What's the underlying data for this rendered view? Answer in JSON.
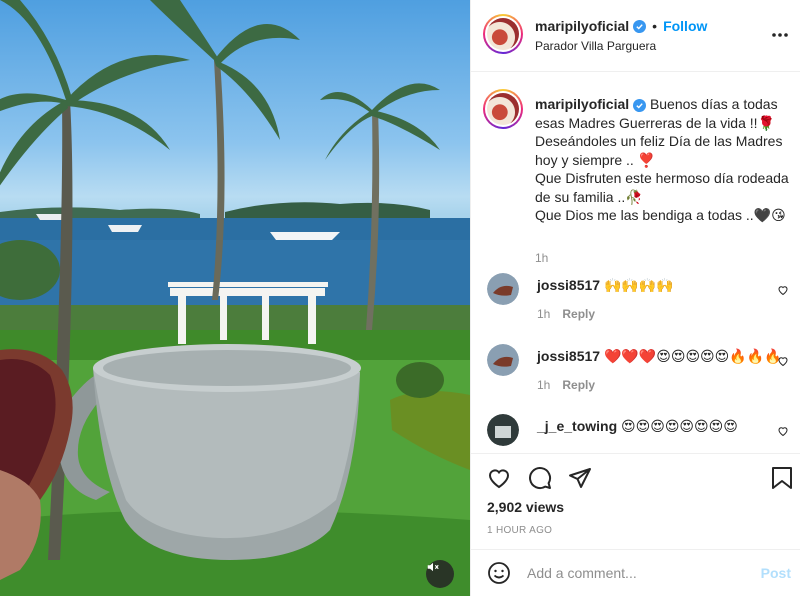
{
  "post": {
    "author": "maripilyoficial",
    "follow_label": "Follow",
    "location": "Parador Villa Parguera",
    "more_icon": "more-horizontal-icon"
  },
  "caption": {
    "username": "maripilyoficial",
    "text": "Buenos días a todas esas Madres Guerreras de la vida !!🌹\nDeseándoles un feliz Día de las Madres hoy y siempre .. ❣️\nQue Disfruten este hermoso día rodeada de su familia ..🥀\nQue Dios me las bendiga a todas ..🖤😘",
    "time": "1h"
  },
  "comments": [
    {
      "username": "jossi8517",
      "text": "🙌🙌🙌🙌",
      "time": "1h",
      "reply_label": "Reply"
    },
    {
      "username": "jossi8517",
      "text": "❤️❤️❤️😍😍😍😍😍🔥🔥🔥",
      "time": "1h",
      "reply_label": "Reply"
    },
    {
      "username": "_j_e_towing",
      "text": "😍😍😍😍😍😍😍😍",
      "time": "",
      "reply_label": ""
    }
  ],
  "stats": {
    "views": "2,902 views",
    "time_ago": "1 HOUR AGO"
  },
  "composer": {
    "placeholder": "Add a comment...",
    "post_label": "Post"
  },
  "colors": {
    "accent": "#0095f6",
    "post_disabled": "#b2dffc",
    "muted": "#8e8e8e",
    "border": "#efefef"
  }
}
